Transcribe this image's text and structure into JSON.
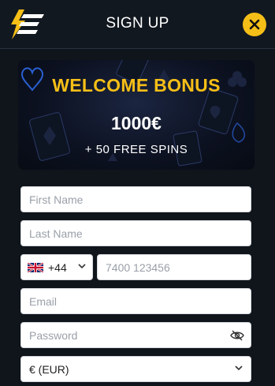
{
  "header": {
    "title": "SIGN UP",
    "logo_icon": "lightning-logo-icon",
    "close_icon": "close-icon",
    "accent_color": "#f6bf17"
  },
  "banner": {
    "title": "WELCOME BONUS",
    "amount": "1000€",
    "spins": "+ 50 FREE SPINS"
  },
  "form": {
    "first_name": {
      "placeholder": "First Name",
      "value": ""
    },
    "last_name": {
      "placeholder": "Last Name",
      "value": ""
    },
    "phone_code": {
      "flag_icon": "uk-flag-icon",
      "value": "+44"
    },
    "phone": {
      "placeholder": "7400 123456",
      "value": ""
    },
    "email": {
      "placeholder": "Email",
      "value": ""
    },
    "password": {
      "placeholder": "Password",
      "value": "",
      "toggle_icon": "eye-slash-icon"
    },
    "currency": {
      "value": "€ (EUR)"
    }
  }
}
